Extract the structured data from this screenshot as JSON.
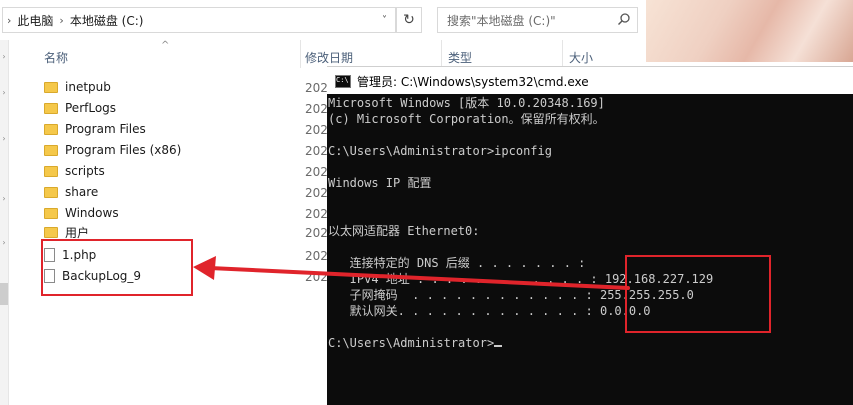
{
  "explorer": {
    "breadcrumb": [
      "此电脑",
      "本地磁盘 (C:)"
    ],
    "search_placeholder": "搜索\"本地磁盘 (C:)\"",
    "columns": {
      "name": "名称",
      "date": "修改日期",
      "type": "类型",
      "size": "大小"
    },
    "items": [
      {
        "name": "inetpub",
        "kind": "folder",
        "date": "202"
      },
      {
        "name": "PerfLogs",
        "kind": "folder",
        "date": "202"
      },
      {
        "name": "Program Files",
        "kind": "folder",
        "date": "202"
      },
      {
        "name": "Program Files (x86)",
        "kind": "folder",
        "date": "202"
      },
      {
        "name": "scripts",
        "kind": "folder",
        "date": "202"
      },
      {
        "name": "share",
        "kind": "folder",
        "date": "202"
      },
      {
        "name": "Windows",
        "kind": "folder",
        "date": "202"
      },
      {
        "name": "用户",
        "kind": "folder",
        "date": "202"
      },
      {
        "name": "1.php",
        "kind": "file",
        "date": "202"
      },
      {
        "name": "BackupLog_9",
        "kind": "file",
        "date": "202"
      }
    ]
  },
  "cmd": {
    "title": "管理员: C:\\Windows\\system32\\cmd.exe",
    "lines": [
      "Microsoft Windows [版本 10.0.20348.169]",
      "(c) Microsoft Corporation。保留所有权利。",
      "",
      "C:\\Users\\Administrator>ipconfig",
      "",
      "Windows IP 配置",
      "",
      "",
      "以太网适配器 Ethernet0:",
      "",
      "   连接特定的 DNS 后缀 . . . . . . . :",
      "   IPv4 地址 . . . . . . . . . . . . : 192.168.227.129",
      "   子网掩码  . . . . . . . . . . . . : 255.255.255.0",
      "   默认网关. . . . . . . . . . . . . : 0.0.0.0",
      "",
      "C:\\Users\\Administrator>"
    ]
  },
  "colors": {
    "highlight": "#e0242b",
    "terminal_bg": "#0c0c0c",
    "terminal_fg": "#cccccc"
  }
}
